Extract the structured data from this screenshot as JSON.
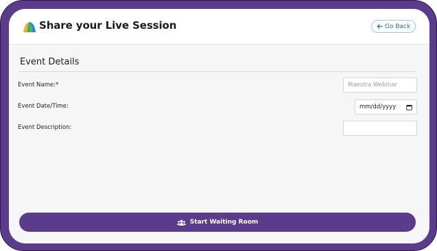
{
  "header": {
    "title": "Share your Live Session",
    "go_back_label": "Go Back",
    "logo_colors": [
      "#f0b429",
      "#4caf50",
      "#1e88e5"
    ]
  },
  "section": {
    "title": "Event Details"
  },
  "form": {
    "event_name_label": "Event Name:*",
    "event_name_placeholder": "Maestra Webinar",
    "event_name_value": "",
    "event_datetime_label": "Event Date/Time:",
    "event_datetime_placeholder": "mm/dd/yyyy",
    "event_description_label": "Event Description:",
    "event_description_value": ""
  },
  "actions": {
    "start_label": "Start Waiting Room"
  },
  "colors": {
    "brand_purple": "#5a3b8c",
    "link_blue": "#1a6fc9"
  }
}
